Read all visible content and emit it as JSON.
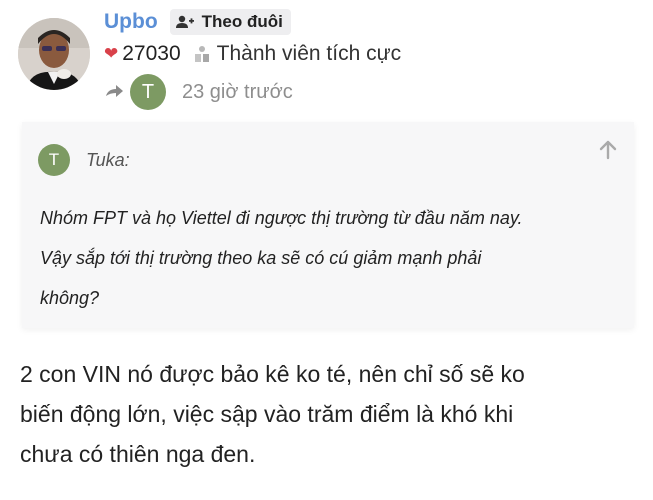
{
  "user": {
    "username": "Upbo",
    "follow_label": "Theo đuôi",
    "likes": "27030",
    "rank": "Thành viên tích cực"
  },
  "reply": {
    "avatar_letter": "T",
    "time": "23 giờ trước"
  },
  "quote": {
    "avatar_letter": "T",
    "author": "Tuka:",
    "lines": [
      "Nhóm FPT và họ Viettel đi ngược thị trường từ đầu năm nay.",
      "Vậy sắp tới thị trường theo ka sẽ có cú giảm mạnh phải",
      "không?"
    ]
  },
  "post": {
    "lines": [
      "2 con VIN nó được bảo kê ko té, nên chỉ số sẽ ko",
      "biến động lớn, việc sập vào trăm điểm là khó khi",
      "chưa có thiên nga đen."
    ]
  },
  "colors": {
    "username": "#5b8fd6",
    "heart": "#d9414a",
    "avatar_green": "#7d9a63",
    "quote_bg": "#f7f7f8"
  },
  "icons": [
    "add-user-icon",
    "heart-icon",
    "rank-icon",
    "reply-icon",
    "arrow-up-icon"
  ]
}
